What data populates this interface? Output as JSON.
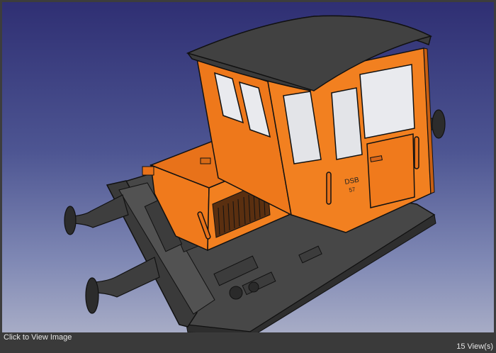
{
  "viewer": {
    "caption": "Click to View Image",
    "views": "15 View(s)"
  },
  "model": {
    "cab_number": "57",
    "cab_lettering": "DSB",
    "body_color": "#f07a1c",
    "roof_color": "#3b3b3b",
    "chassis_color": "#474747",
    "background_top": "#2f2f73",
    "background_bottom": "#a7acc6"
  }
}
